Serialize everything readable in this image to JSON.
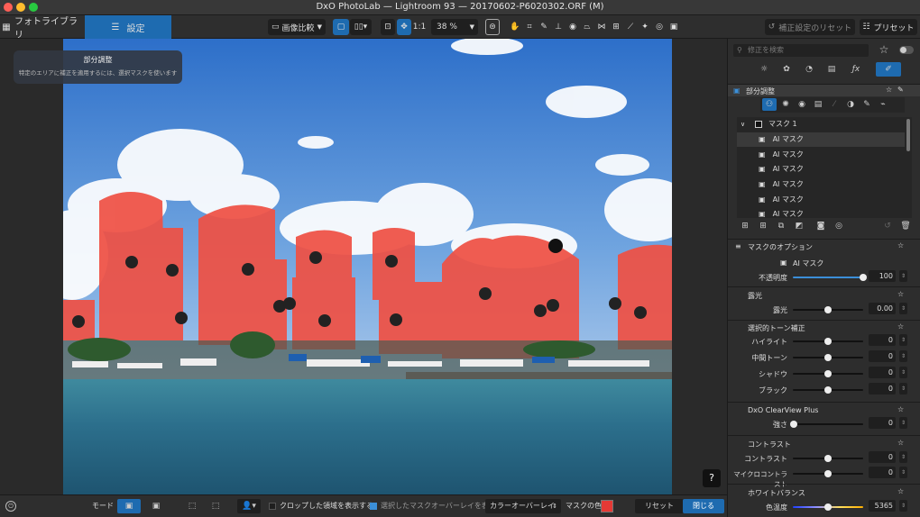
{
  "window": {
    "title": "DxO PhotoLab — Lightroom 93 — 20170602-P6020302.ORF (M)"
  },
  "tabs": {
    "library": "フォトライブラリ",
    "settings": "設定"
  },
  "toolbar": {
    "compare": "画像比較",
    "ratio": "1:1",
    "zoom": "38 %",
    "reset": "補正設定のリセット",
    "preset": "プリセット"
  },
  "overlay": {
    "title": "部分調整",
    "hint": "特定のエリアに補正を適用するには、選択マスクを使います"
  },
  "help": "?",
  "bottom": {
    "mode": "モード",
    "show_crop": "クロップした領域を表示する",
    "show_overlay": "選択したマスクオーバーレイを表示",
    "overlay_type": "カラーオーバーレイ",
    "mask_color_label": "マスクの色",
    "mask_color": "#e53935",
    "reset": "リセット",
    "close": "閉じる"
  },
  "search": {
    "placeholder": "修正を検索"
  },
  "local": {
    "title": "部分調整",
    "mask_group": "マスク 1",
    "masks": [
      "AI マスク",
      "AI マスク",
      "AI マスク",
      "AI マスク",
      "AI マスク",
      "AI マスク"
    ]
  },
  "mask_options": {
    "title": "マスクのオプション",
    "type": "AI マスク",
    "opacity_label": "不透明度",
    "opacity": "100"
  },
  "exposure": {
    "title": "露光",
    "label": "露光",
    "value": "0.00"
  },
  "tone": {
    "title": "選択的トーン補正",
    "highlight": "ハイライト",
    "midtone": "中間トーン",
    "shadow": "シャドウ",
    "black": "ブラック",
    "values": [
      "0",
      "0",
      "0",
      "0"
    ]
  },
  "clearview": {
    "title": "DxO ClearView Plus",
    "label": "強さ",
    "value": "0"
  },
  "contrast": {
    "title": "コントラスト",
    "contrast": "コントラスト",
    "micro": "マイクロコントラスト",
    "values": [
      "0",
      "0"
    ]
  },
  "wb": {
    "title": "ホワイトバランス",
    "temp": "色温度",
    "value": "5365"
  },
  "accent": "#3b8fd8"
}
